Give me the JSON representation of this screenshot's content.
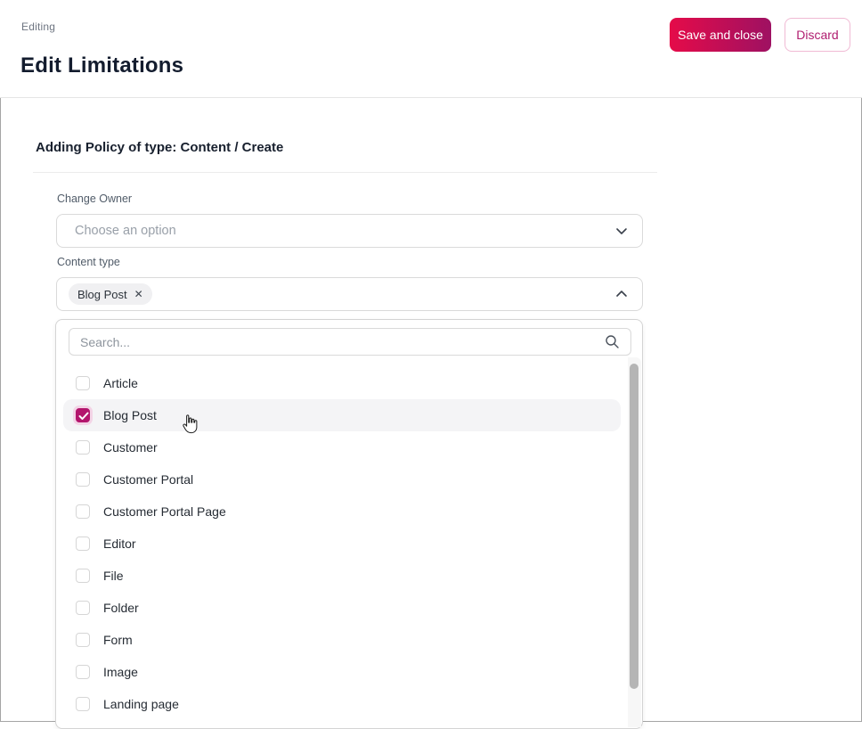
{
  "header": {
    "breadcrumb": "Editing",
    "title": "Edit Limitations",
    "save_label": "Save and close",
    "discard_label": "Discard"
  },
  "form": {
    "section_heading": "Adding Policy of type: Content / Create",
    "change_owner": {
      "label": "Change Owner",
      "placeholder": "Choose an option"
    },
    "content_type": {
      "label": "Content type",
      "selected_chip": "Blog Post",
      "remove_icon": "✕"
    }
  },
  "dropdown": {
    "search_placeholder": "Search...",
    "options": [
      {
        "label": "Article",
        "checked": false,
        "highlighted": false
      },
      {
        "label": "Blog Post",
        "checked": true,
        "highlighted": true
      },
      {
        "label": "Customer",
        "checked": false,
        "highlighted": false
      },
      {
        "label": "Customer Portal",
        "checked": false,
        "highlighted": false
      },
      {
        "label": "Customer Portal Page",
        "checked": false,
        "highlighted": false
      },
      {
        "label": "Editor",
        "checked": false,
        "highlighted": false
      },
      {
        "label": "File",
        "checked": false,
        "highlighted": false
      },
      {
        "label": "Folder",
        "checked": false,
        "highlighted": false
      },
      {
        "label": "Form",
        "checked": false,
        "highlighted": false
      },
      {
        "label": "Image",
        "checked": false,
        "highlighted": false
      },
      {
        "label": "Landing page",
        "checked": false,
        "highlighted": false
      }
    ]
  },
  "icons": {
    "search": "magnifier",
    "chevron_down": "chevron-down",
    "chevron_up": "chevron-up",
    "checkbox_check": "check",
    "chip_close": "✕",
    "cursor": "hand-pointer"
  },
  "colors": {
    "accent_magenta": "#b3156d",
    "save_gradient_start": "#e50b49",
    "save_gradient_end": "#9e1162",
    "discard_border": "#f0bad4",
    "discard_text": "#b01c6f",
    "row_highlight": "#f4f4f6",
    "title_text": "#131c2e"
  }
}
